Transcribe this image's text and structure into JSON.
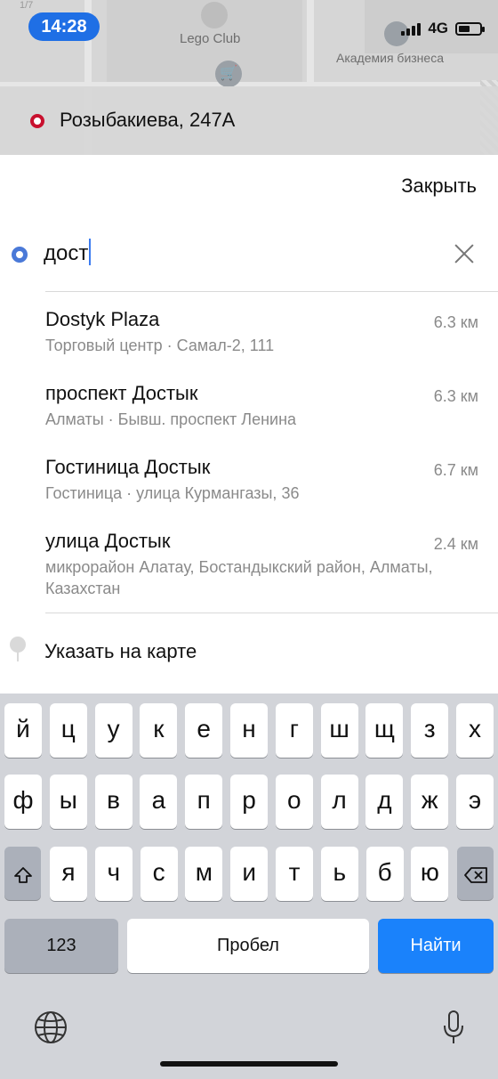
{
  "status": {
    "time": "14:28",
    "network": "4G"
  },
  "map": {
    "label_lego": "Lego Club",
    "label_academy": "Академия бизнеса",
    "corner_number": "1/7"
  },
  "route": {
    "from_address": "Розыбакиева, 247А"
  },
  "sheet": {
    "close_label": "Закрыть",
    "search_value": "дост",
    "results": [
      {
        "title": "Dostyk Plaza",
        "subtitle": "Торговый центр · Самал-2, 111",
        "distance": "6.3 км"
      },
      {
        "title": "проспект Достык",
        "subtitle": "Алматы ·  Бывш. проспект Ленина",
        "distance": "6.3 км"
      },
      {
        "title": "Гостиница Достык",
        "subtitle": "Гостиница · улица Курмангазы, 36",
        "distance": "6.7 км"
      },
      {
        "title": "улица Достык",
        "subtitle": "микрорайон Алатау, Бостандыкский район, Алматы, Казахстан",
        "distance": "2.4 км"
      }
    ],
    "point_on_map_label": "Указать на карте"
  },
  "keyboard": {
    "row1": [
      "й",
      "ц",
      "у",
      "к",
      "е",
      "н",
      "г",
      "ш",
      "щ",
      "з",
      "х"
    ],
    "row2": [
      "ф",
      "ы",
      "в",
      "а",
      "п",
      "р",
      "о",
      "л",
      "д",
      "ж",
      "э"
    ],
    "row3": [
      "я",
      "ч",
      "с",
      "м",
      "и",
      "т",
      "ь",
      "б",
      "ю"
    ],
    "numbers_label": "123",
    "space_label": "Пробел",
    "go_label": "Найти"
  },
  "colors": {
    "accent_blue": "#1a82fb",
    "time_pill": "#1f6fe5",
    "from_marker": "#c8102e",
    "to_marker": "#4a79d8"
  }
}
